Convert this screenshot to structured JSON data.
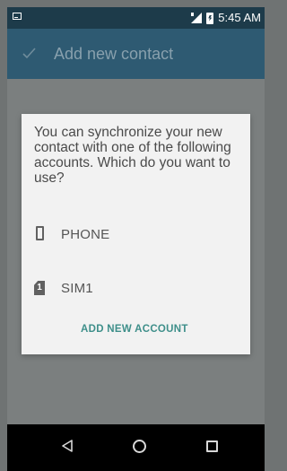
{
  "status_bar": {
    "time": "5:45 AM",
    "left_icon": "notification-icon",
    "signal_icon": "signal-icon",
    "battery_icon": "battery-charging-icon"
  },
  "app_bar": {
    "title": "Add new contact",
    "action_icon": "check-icon"
  },
  "dialog": {
    "message": "You can synchronize your new contact with one of the following accounts. Which do you want to use?",
    "accounts": [
      {
        "label": "PHONE",
        "icon": "phone-icon"
      },
      {
        "label": "SIM1",
        "icon": "sim-card-icon",
        "icon_text": "1"
      }
    ],
    "add_account_label": "ADD NEW ACCOUNT"
  },
  "nav_bar": {
    "back_icon": "back-icon",
    "home_icon": "home-icon",
    "recents_icon": "recents-icon"
  },
  "colors": {
    "status_bar": "#1d3b4a",
    "app_bar": "#2e5a72",
    "dim_overlay": "#7b7f7f",
    "dialog_bg": "#f2f2f2",
    "accent": "#3e8f8a"
  }
}
